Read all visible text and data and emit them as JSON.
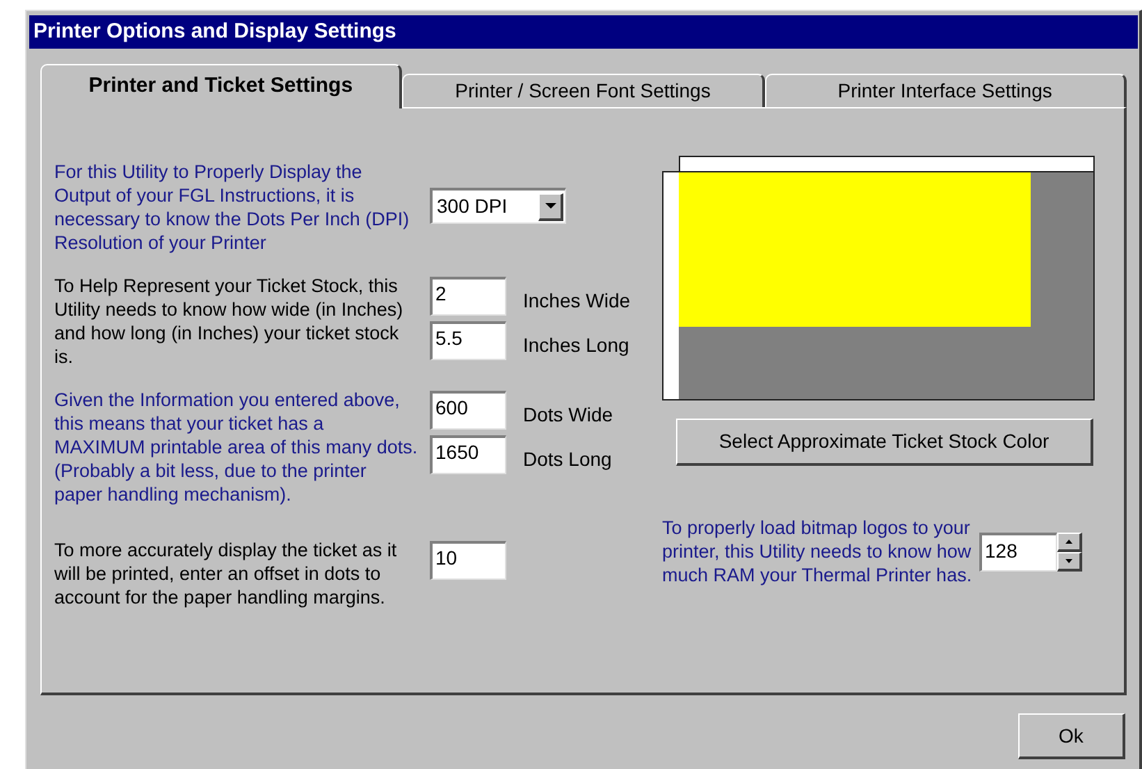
{
  "window": {
    "title": "Printer Options and Display Settings"
  },
  "tabs": [
    {
      "label": "Printer and Ticket Settings",
      "selected": true
    },
    {
      "label": "Printer / Screen Font Settings",
      "selected": false
    },
    {
      "label": "Printer Interface Settings",
      "selected": false
    }
  ],
  "sections": [
    {
      "kind": "select",
      "description": "For this Utility to Properly Display the Output of your FGL Instructions, it is necessary to know the Dots Per Inch (DPI) Resolution of your Printer",
      "highlighted": true,
      "fields": [
        {
          "value": "300 DPI"
        }
      ]
    },
    {
      "kind": "fields",
      "description": "To Help Represent your Ticket Stock, this Utility needs to know how wide (in Inches) and how long (in Inches) your ticket stock is.",
      "highlighted": false,
      "fields": [
        {
          "value": "2",
          "unit": "Inches Wide"
        },
        {
          "value": "5.5",
          "unit": "Inches Long"
        }
      ]
    },
    {
      "kind": "fields",
      "description": "Given the Information you entered above, this means that your ticket has a MAXIMUM printable area of this many dots.  (Probably a bit less, due to the printer paper handling mechanism).",
      "highlighted": true,
      "fields": [
        {
          "value": "600",
          "unit": "Dots Wide"
        },
        {
          "value": "1650",
          "unit": "Dots Long"
        }
      ]
    },
    {
      "kind": "fields",
      "description": "To more accurately display the ticket as it will be printed, enter an offset in dots to account for the paper handling margins.",
      "highlighted": false,
      "fields": [
        {
          "value": "10"
        }
      ]
    }
  ],
  "color_button": "Select Approximate Ticket Stock Color",
  "ram": {
    "description": "To properly load bitmap logos to your printer, this Utility needs to know how much RAM your Thermal Printer has.",
    "highlighted": true,
    "value": "128"
  },
  "ok_button": "Ok"
}
